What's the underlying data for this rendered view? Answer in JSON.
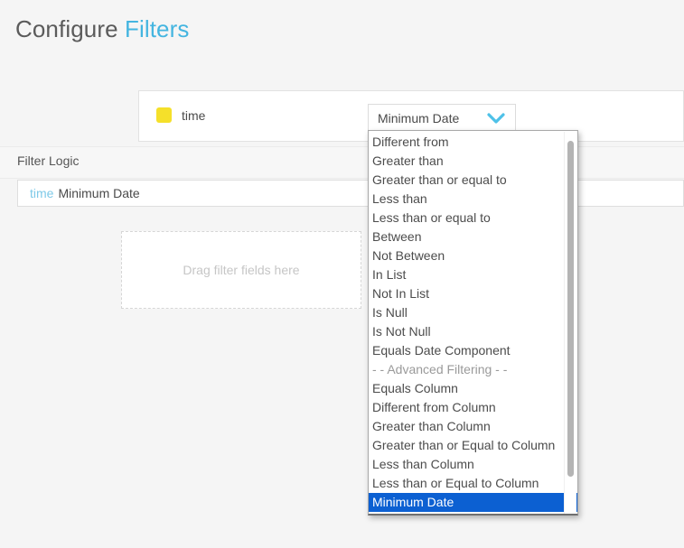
{
  "header": {
    "title_primary": "Configure",
    "title_accent": "Filters"
  },
  "filter_row": {
    "field_swatch_color": "#f5e02a",
    "field_label": "time",
    "operator_select": {
      "value": "Minimum Date",
      "chevron_color": "#4ec1e8"
    }
  },
  "filter_logic": {
    "label": "Filter Logic",
    "expression_token": "time",
    "expression_rest": "Minimum Date"
  },
  "dropzone": {
    "placeholder": "Drag filter fields here"
  },
  "dropdown": {
    "selected_value": "Minimum Date",
    "highlight_color": "#0c60d2",
    "items": [
      {
        "label": "Different from",
        "type": "option"
      },
      {
        "label": "Greater than",
        "type": "option"
      },
      {
        "label": "Greater than or equal to",
        "type": "option"
      },
      {
        "label": "Less than",
        "type": "option"
      },
      {
        "label": "Less than or equal to",
        "type": "option"
      },
      {
        "label": "Between",
        "type": "option"
      },
      {
        "label": "Not Between",
        "type": "option"
      },
      {
        "label": "In List",
        "type": "option"
      },
      {
        "label": "Not In List",
        "type": "option"
      },
      {
        "label": "Is Null",
        "type": "option"
      },
      {
        "label": "Is Not Null",
        "type": "option"
      },
      {
        "label": "Equals Date Component",
        "type": "option"
      },
      {
        "label": "- - Advanced Filtering - -",
        "type": "separator"
      },
      {
        "label": "Equals Column",
        "type": "option"
      },
      {
        "label": "Different from Column",
        "type": "option"
      },
      {
        "label": "Greater than Column",
        "type": "option"
      },
      {
        "label": "Greater than or Equal to Column",
        "type": "option"
      },
      {
        "label": "Less than Column",
        "type": "option"
      },
      {
        "label": "Less than or Equal to Column",
        "type": "option"
      },
      {
        "label": "Minimum Date",
        "type": "option",
        "selected": true
      }
    ]
  }
}
